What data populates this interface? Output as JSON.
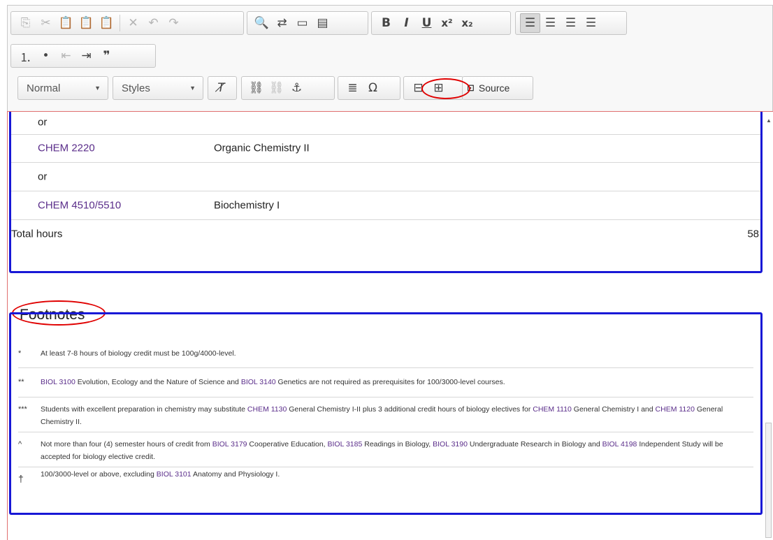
{
  "toolbar": {
    "row1_icons": [
      "copy-icon",
      "cut-icon",
      "paste-icon",
      "paste-text-icon",
      "paste-word-icon",
      "remove-icon",
      "undo-icon",
      "redo-icon",
      "find-icon",
      "replace-icon",
      "select-all-icon",
      "spellcheck-icon",
      "bold-icon",
      "italic-icon",
      "underline-icon",
      "superscript-icon",
      "subscript-icon",
      "align-left-icon",
      "align-center-icon",
      "align-right-icon",
      "justify-icon"
    ],
    "row2_icons": [
      "numbered-list-icon",
      "bulleted-list-icon",
      "outdent-icon",
      "indent-icon",
      "blockquote-icon"
    ],
    "format_combo": "Normal",
    "styles_combo": "Styles",
    "source_label": "Source"
  },
  "courses": [
    {
      "code": "or",
      "title": ""
    },
    {
      "code": "CHEM 2220",
      "title": "Organic Chemistry II"
    },
    {
      "code": "or",
      "title": ""
    },
    {
      "code": "CHEM 4510/5510",
      "title": "Biochemistry I"
    }
  ],
  "total": {
    "label": "Total hours",
    "value": "58"
  },
  "footnotes_heading": "Footnotes",
  "footnotes": [
    {
      "mark": "*",
      "parts": [
        {
          "t": "At least 7-8 hours of biology credit must be 100g/4000-level."
        }
      ]
    },
    {
      "mark": "**",
      "parts": [
        {
          "t": "BIOL 3100",
          "link": true
        },
        {
          "t": " Evolution, Ecology and the Nature of Science and "
        },
        {
          "t": "BIOL 3140",
          "link": true
        },
        {
          "t": " Genetics are not required as prerequisites for 100/3000-level courses."
        }
      ]
    },
    {
      "mark": "***",
      "parts": [
        {
          "t": "Students with excellent preparation in chemistry may substitute "
        },
        {
          "t": "CHEM 1130",
          "link": true
        },
        {
          "t": " General Chemistry I-II plus 3 additional credit hours of biology electives for "
        },
        {
          "t": "CHEM 1110",
          "link": true
        },
        {
          "t": " General Chemistry I and "
        },
        {
          "t": "CHEM 1120",
          "link": true
        },
        {
          "t": " General Chemistry II."
        }
      ]
    },
    {
      "mark": "^",
      "parts": [
        {
          "t": "Not more than four (4) semester hours of credit from "
        },
        {
          "t": "BIOL 3179",
          "link": true
        },
        {
          "t": " Cooperative Education, "
        },
        {
          "t": "BIOL 3185",
          "link": true
        },
        {
          "t": " Readings in Biology, "
        },
        {
          "t": "BIOL 3190",
          "link": true
        },
        {
          "t": " Undergraduate Research in Biology and "
        },
        {
          "t": "BIOL 4198",
          "link": true
        },
        {
          "t": " Independent Study will be accepted for biology elective credit."
        }
      ]
    },
    {
      "mark": "†",
      "parts": [
        {
          "t": "100/3000-level or above, excluding "
        },
        {
          "t": "BIOL 3101",
          "link": true
        },
        {
          "t": " Anatomy and Physiology I."
        }
      ]
    }
  ],
  "colors": {
    "link": "#5a2d8a",
    "highlight_box": "#1818d6",
    "annotation": "#e00000"
  }
}
